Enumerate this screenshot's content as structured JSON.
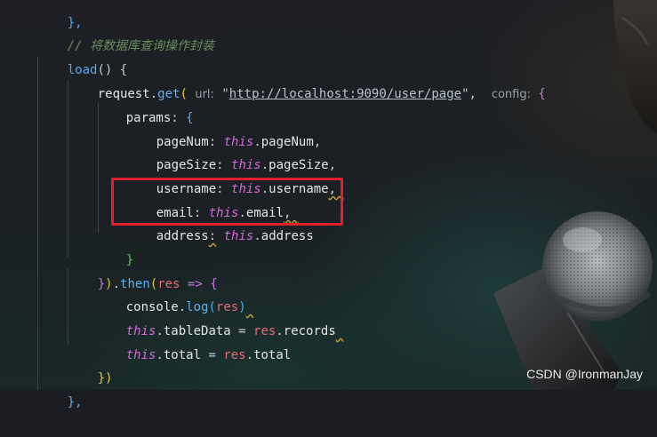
{
  "code": {
    "line0": "},",
    "comment": "// 将数据库查询操作封装",
    "load_name": "load",
    "load_rest": "() {",
    "request": "request",
    "get": "get",
    "url_hint": "url:",
    "url_value": "http://localhost:9090/user/page",
    "config_hint": "config:",
    "params": "params",
    "pageNum_key": "pageNum",
    "pageNum_val": "pageNum",
    "pageSize_key": "pageSize",
    "pageSize_val": "pageSize",
    "username_key": "username",
    "username_val": "username",
    "email_key": "email",
    "email_val": "email",
    "address_key": "address",
    "address_val": "address",
    "this_kw": "this",
    "then": "then",
    "res": "res",
    "console": "console",
    "log": "log",
    "tableData": "tableData",
    "records": "records",
    "total": "total"
  },
  "watermark": "CSDN @IronmanJay"
}
